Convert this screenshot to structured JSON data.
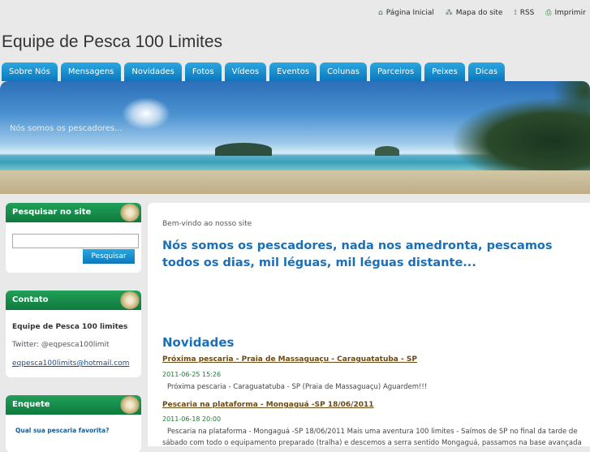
{
  "top_links": [
    {
      "icon": "home-icon",
      "glyph": "⌂",
      "label": "Página Inicial"
    },
    {
      "icon": "sitemap-icon",
      "glyph": "⁂",
      "label": "Mapa do site"
    },
    {
      "icon": "rss-icon",
      "glyph": "⟟",
      "label": "RSS"
    },
    {
      "icon": "print-icon",
      "glyph": "⎙",
      "label": "Imprimir"
    }
  ],
  "site_title": "Equipe de Pesca 100 Limites",
  "nav": [
    "Sobre Nós",
    "Mensagens",
    "Novidades",
    "Fotos",
    "Vídeos",
    "Eventos",
    "Colunas",
    "Parceiros",
    "Peixes",
    "Dicas"
  ],
  "banner": {
    "caption": "Nós somos os pescadores..."
  },
  "search": {
    "title": "Pesquisar no site",
    "button": "Pesquisar",
    "value": ""
  },
  "contact": {
    "title": "Contato",
    "name": "Equipe de Pesca 100 limites",
    "twitter": "Twitter: @eqpesca100limit",
    "email": "eqpesca100limits@hotmail.com"
  },
  "poll": {
    "title": "Enquete",
    "question": "Qual sua pescaria favorita?"
  },
  "main": {
    "welcome": "Bem-vindo ao nosso site",
    "headline": "Nós somos os pescadores, nada nos amedronta, pescamos todos os dias, mil léguas, mil léguas distante...",
    "news_title": "Novidades",
    "posts": [
      {
        "title": "Próxima pescaria - Praia de Massaguaçu - Caraguatatuba - SP",
        "date": "2011-06-25 15:26",
        "body": "Próxima pescaria - Caraguatatuba - SP (Praia de Massaguaçu) Aguardem!!!"
      },
      {
        "title": "Pescaria na plataforma - Mongaguá -SP 18/06/2011",
        "date": "2011-06-18 20:00",
        "body": "Pescaria na plataforma - Mongaguá -SP 18/06/2011 Mais uma aventura 100 limites - Saímos de SP no final da tarde de sábado com todo o equipamento preparado (tralha) e descemos a serra sentido Mongaguá, passamos na base avançada"
      }
    ]
  }
}
